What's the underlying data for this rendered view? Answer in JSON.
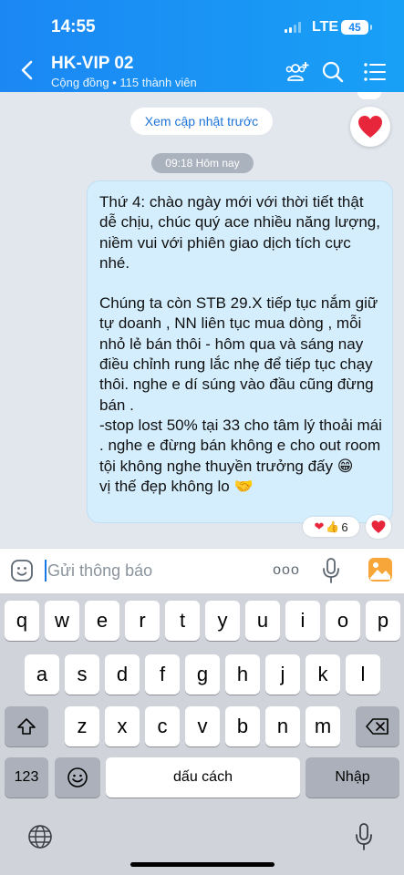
{
  "status": {
    "time": "14:55",
    "network": "LTE",
    "battery": "45"
  },
  "header": {
    "title": "HK-VIP 02",
    "subtitle": "Cộng đồng • 115 thành viên"
  },
  "chat": {
    "load_previous": "Xem cập nhật trước",
    "time_separator": "09:18 Hôm nay",
    "message": {
      "paragraph1": "Thứ 4: chào ngày mới với thời tiết thật dễ chịu, chúc quý ace nhiều năng lượng, niềm vui với phiên giao dịch tích cực nhé.",
      "line1": "Chúng ta còn STB 29.X tiếp tục nắm giữ",
      "line2": "tự doanh , NN liên tục mua dòng , mỗi nhỏ lẻ bán thôi - hôm qua và sáng nay điều chỉnh rung lắc nhẹ để tiếp tục chạy thôi. nghe e dí súng vào đầu cũng đừng bán .",
      "line3": "-stop lost 50% tại 33 cho tâm lý thoải mái . nghe e đừng bán không e cho out room tội không nghe thuyền trưởng đấy 😁",
      "line4": "vị thế đẹp không lo 🤝"
    },
    "reaction_count": "6"
  },
  "composer": {
    "placeholder": "Gửi thông báo",
    "more": "ooo"
  },
  "keyboard": {
    "row1": [
      "q",
      "w",
      "e",
      "r",
      "t",
      "y",
      "u",
      "i",
      "o",
      "p"
    ],
    "row2": [
      "a",
      "s",
      "d",
      "f",
      "g",
      "h",
      "j",
      "k",
      "l"
    ],
    "row3": [
      "z",
      "x",
      "c",
      "v",
      "b",
      "n",
      "m"
    ],
    "numbers_key": "123",
    "space_key": "dấu cách",
    "return_key": "Nhập"
  },
  "colors": {
    "header": "#1b87f3",
    "bubble": "#d5eefd",
    "accent": "#1d74d8",
    "heart": "#e8263b"
  }
}
